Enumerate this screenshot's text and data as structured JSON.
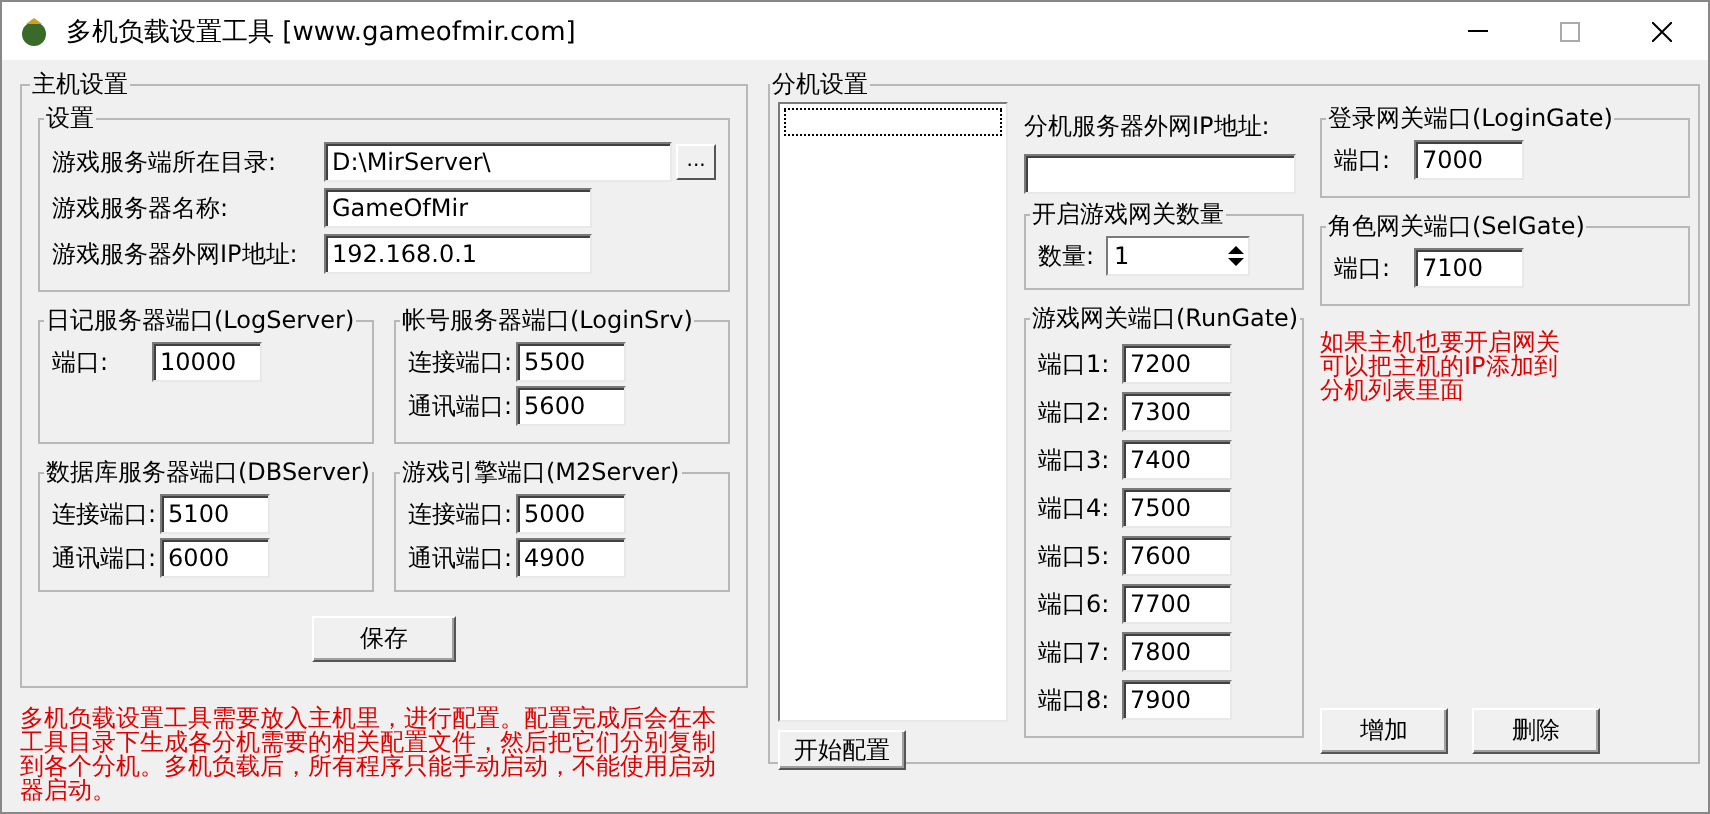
{
  "window": {
    "title": "多机负载设置工具 [www.gameofmir.com]"
  },
  "host": {
    "title": "主机设置",
    "settings": {
      "title": "设置",
      "browse_button": "...",
      "fields": [
        {
          "label": "游戏服务端所在目录:",
          "value": "D:\\MirServer\\",
          "kind": "browse"
        },
        {
          "label": "游戏服务器名称:",
          "value": "GameOfMir",
          "kind": "text"
        },
        {
          "label": "游戏服务器外网IP地址:",
          "value": "192.168.0.1",
          "kind": "text"
        }
      ]
    },
    "port_groups": [
      {
        "title": "日记服务器端口(LogServer)",
        "ports": [
          {
            "label": "端口:",
            "value": "10000"
          }
        ]
      },
      {
        "title": "帐号服务器端口(LoginSrv)",
        "ports": [
          {
            "label": "连接端口:",
            "value": "5500"
          },
          {
            "label": "通讯端口:",
            "value": "5600"
          }
        ]
      },
      {
        "title": "数据库服务器端口(DBServer)",
        "ports": [
          {
            "label": "连接端口:",
            "value": "5100"
          },
          {
            "label": "通讯端口:",
            "value": "6000"
          }
        ]
      },
      {
        "title": "游戏引擎端口(M2Server)",
        "ports": [
          {
            "label": "连接端口:",
            "value": "5000"
          },
          {
            "label": "通讯端口:",
            "value": "4900"
          }
        ]
      }
    ],
    "save_button": "保存"
  },
  "note": "多机负载设置工具需要放入主机里，进行配置。配置完成后会在本工具目录下生成各分机需要的相关配置文件，然后把它们分别复制到各个分机。多机负载后，所有程序只能手动启动，不能使用启动器启动。",
  "slave": {
    "title": "分机设置",
    "start_button": "开始配置",
    "ip_label": "分机服务器外网IP地址:",
    "gate_count": {
      "title": "开启游戏网关数量",
      "label": "数量:",
      "value": "1"
    },
    "run_gate": {
      "title": "游戏网关端口(RunGate)",
      "ports": [
        {
          "label": "端口1:",
          "value": "7200"
        },
        {
          "label": "端口2:",
          "value": "7300"
        },
        {
          "label": "端口3:",
          "value": "7400"
        },
        {
          "label": "端口4:",
          "value": "7500"
        },
        {
          "label": "端口5:",
          "value": "7600"
        },
        {
          "label": "端口6:",
          "value": "7700"
        },
        {
          "label": "端口7:",
          "value": "7800"
        },
        {
          "label": "端口8:",
          "value": "7900"
        }
      ]
    },
    "gates": [
      {
        "title": "登录网关端口(LoginGate)",
        "ports": [
          {
            "label": "端口:",
            "value": "7000"
          }
        ]
      },
      {
        "title": "角色网关端口(SelGate)",
        "ports": [
          {
            "label": "端口:",
            "value": "7100"
          }
        ]
      }
    ],
    "hint": "如果主机也要开启网关可以把主机的IP添加到分机列表里面",
    "buttons": [
      "增加",
      "删除"
    ]
  }
}
